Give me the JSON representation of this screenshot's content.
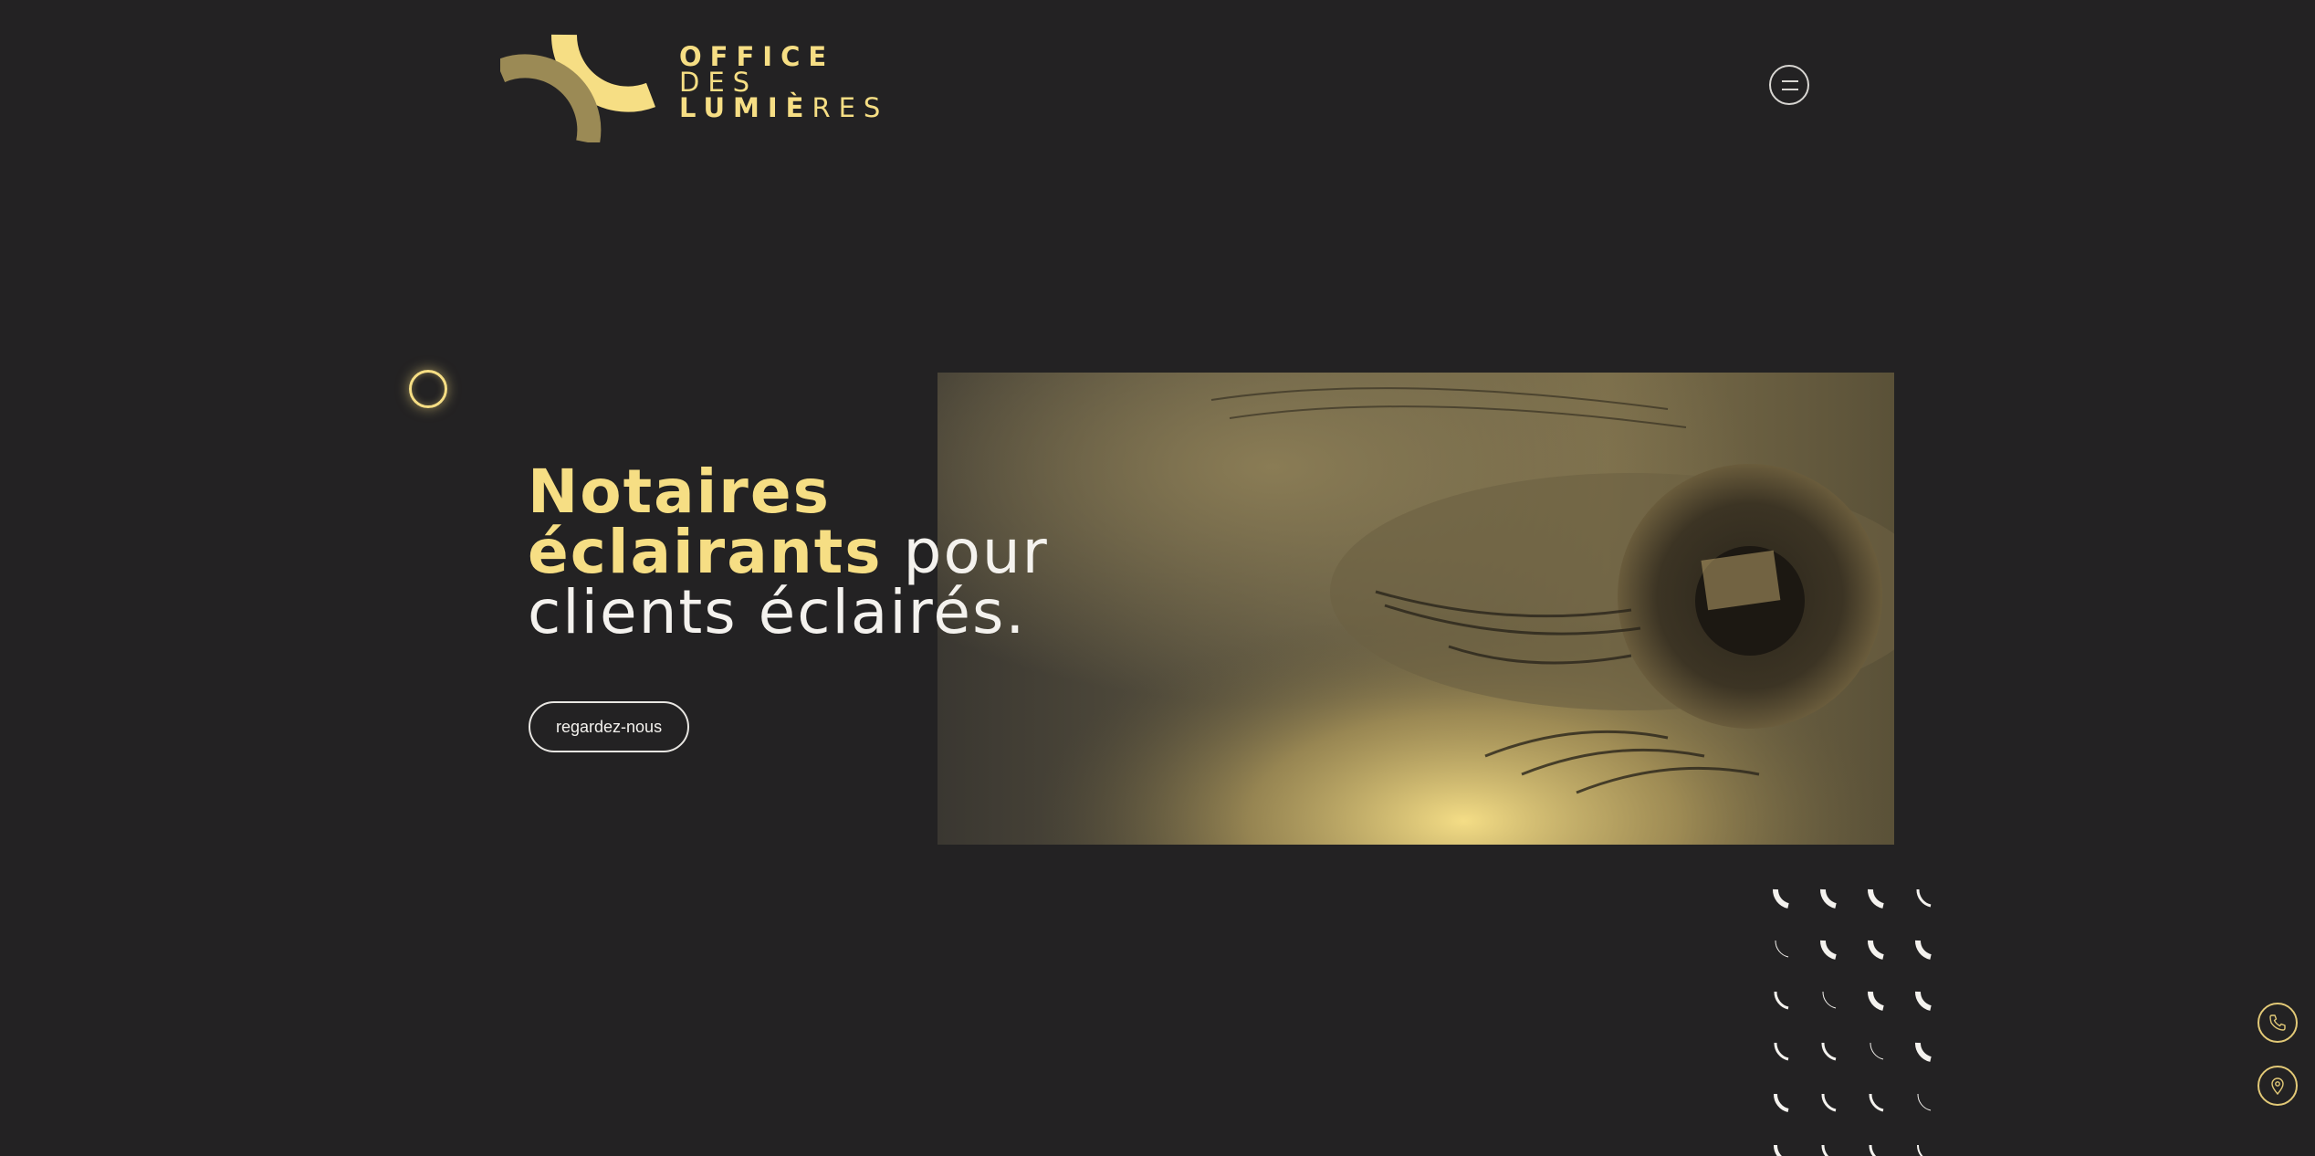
{
  "brand": {
    "line1": "OFFICE",
    "line2": "DES",
    "line3_bold": "LUMIÈ",
    "line3_light": "RES"
  },
  "colors": {
    "background": "#232223",
    "accent": "#f6de84",
    "accent_dark": "#9b8a55",
    "text": "#f4f2ee"
  },
  "header": {
    "menu_icon": "hamburger-icon"
  },
  "hero": {
    "headline_accent_1": "Notaires",
    "headline_accent_2": "éclairants",
    "headline_rest_1": " pour",
    "headline_rest_2": "clients éclairés.",
    "cta_label": "regardez-nous",
    "image_subject": "eye-photo"
  },
  "side_actions": [
    {
      "icon": "phone-icon"
    },
    {
      "icon": "location-pin-icon"
    }
  ]
}
